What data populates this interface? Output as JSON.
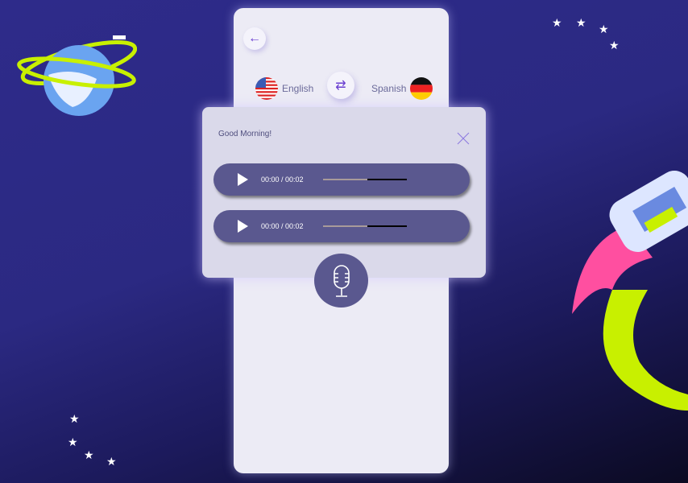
{
  "header": {
    "back_icon": "arrow-left-icon"
  },
  "languages": {
    "source": "English",
    "target": "Spanish",
    "swap_icon": "swap-arrows-icon"
  },
  "modal": {
    "title": "Good Morning!",
    "close_icon": "close-icon",
    "players": [
      {
        "time": "00:00 / 00:02",
        "progress": 0.53
      },
      {
        "time": "00:00 / 00:02",
        "progress": 0.53
      }
    ]
  },
  "mic": {
    "icon": "microphone-icon"
  },
  "colors": {
    "accent": "#5a588f",
    "icon": "#6a3fd0"
  }
}
